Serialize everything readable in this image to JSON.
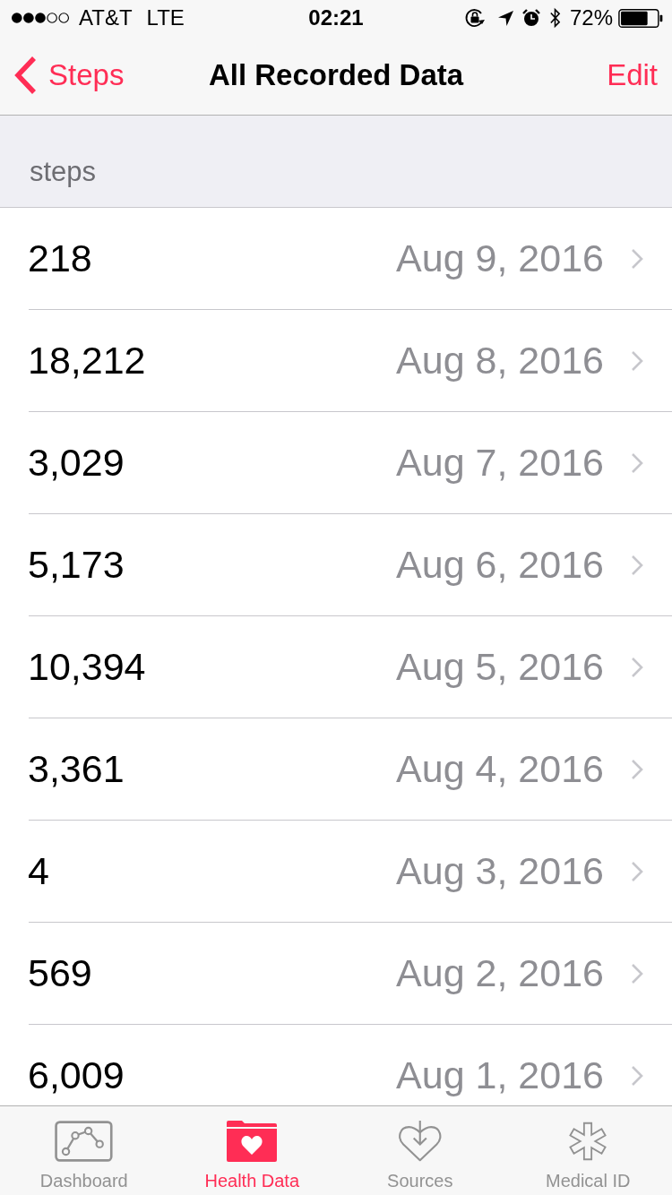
{
  "status_bar": {
    "carrier": "AT&T",
    "network": "LTE",
    "time": "02:21",
    "battery": "72%"
  },
  "nav_bar": {
    "back": "Steps",
    "title": "All Recorded Data",
    "action": "Edit"
  },
  "section": {
    "header": "steps"
  },
  "rows": [
    {
      "value": "218",
      "date": "Aug 9, 2016"
    },
    {
      "value": "18,212",
      "date": "Aug 8, 2016"
    },
    {
      "value": "3,029",
      "date": "Aug 7, 2016"
    },
    {
      "value": "5,173",
      "date": "Aug 6, 2016"
    },
    {
      "value": "10,394",
      "date": "Aug 5, 2016"
    },
    {
      "value": "3,361",
      "date": "Aug 4, 2016"
    },
    {
      "value": "4",
      "date": "Aug 3, 2016"
    },
    {
      "value": "569",
      "date": "Aug 2, 2016"
    },
    {
      "value": "6,009",
      "date": "Aug 1, 2016"
    }
  ],
  "tab_bar": [
    {
      "label": "Dashboard",
      "selected": false
    },
    {
      "label": "Health Data",
      "selected": true
    },
    {
      "label": "Sources",
      "selected": false
    },
    {
      "label": "Medical ID",
      "selected": false
    }
  ]
}
